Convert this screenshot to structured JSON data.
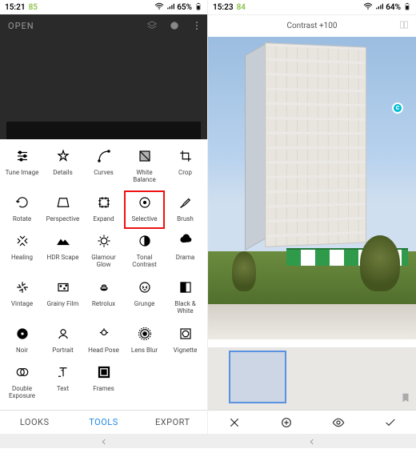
{
  "left": {
    "statusbar": {
      "time": "15:21",
      "extra": "85",
      "battery": "65%"
    },
    "open_label": "OPEN",
    "tools": [
      {
        "name": "tune-image",
        "label": "Tune Image"
      },
      {
        "name": "details",
        "label": "Details"
      },
      {
        "name": "curves",
        "label": "Curves"
      },
      {
        "name": "white-balance",
        "label": "White\nBalance"
      },
      {
        "name": "crop",
        "label": "Crop"
      },
      {
        "name": "rotate",
        "label": "Rotate"
      },
      {
        "name": "perspective",
        "label": "Perspective"
      },
      {
        "name": "expand",
        "label": "Expand"
      },
      {
        "name": "selective",
        "label": "Selective",
        "hl": true
      },
      {
        "name": "brush",
        "label": "Brush"
      },
      {
        "name": "healing",
        "label": "Healing"
      },
      {
        "name": "hdr-scape",
        "label": "HDR Scape"
      },
      {
        "name": "glamour-glow",
        "label": "Glamour\nGlow"
      },
      {
        "name": "tonal-contrast",
        "label": "Tonal\nContrast"
      },
      {
        "name": "drama",
        "label": "Drama"
      },
      {
        "name": "vintage",
        "label": "Vintage"
      },
      {
        "name": "grainy-film",
        "label": "Grainy Film"
      },
      {
        "name": "retrolux",
        "label": "Retrolux"
      },
      {
        "name": "grunge",
        "label": "Grunge"
      },
      {
        "name": "black-white",
        "label": "Black &\nWhite"
      },
      {
        "name": "noir",
        "label": "Noir"
      },
      {
        "name": "portrait",
        "label": "Portrait"
      },
      {
        "name": "head-pose",
        "label": "Head Pose"
      },
      {
        "name": "lens-blur",
        "label": "Lens Blur"
      },
      {
        "name": "vignette",
        "label": "Vignette"
      },
      {
        "name": "double-exposure",
        "label": "Double\nExposure"
      },
      {
        "name": "text",
        "label": "Text"
      },
      {
        "name": "frames",
        "label": "Frames"
      }
    ],
    "tabs": {
      "looks": "LOOKS",
      "tools": "TOOLS",
      "export": "EXPORT"
    }
  },
  "right": {
    "statusbar": {
      "time": "15:23",
      "extra": "84",
      "battery": "64%"
    },
    "title": "Contrast +100",
    "control_badge": "c"
  }
}
